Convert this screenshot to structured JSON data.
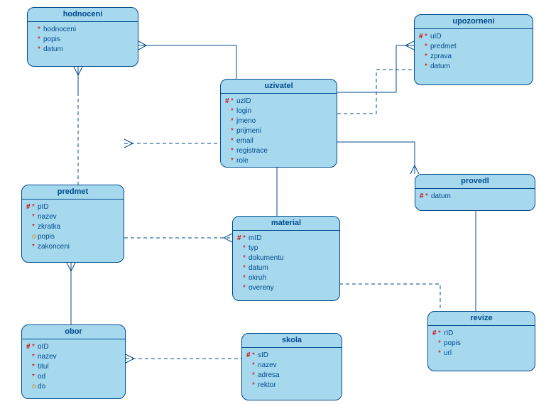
{
  "entities": {
    "hodnoceni": {
      "title": "hodnoceni",
      "attrs": [
        {
          "m": "*",
          "n": "hodnoceni"
        },
        {
          "m": "*",
          "n": "popis"
        },
        {
          "m": "*",
          "n": "datum"
        }
      ]
    },
    "upozorneni": {
      "title": "upozorneni",
      "attrs": [
        {
          "m": "#",
          "n": "uID"
        },
        {
          "m": "*",
          "n": "predmet"
        },
        {
          "m": "*",
          "n": "zprava"
        },
        {
          "m": "*",
          "n": "datum"
        }
      ]
    },
    "uzivatel": {
      "title": "uzivatel",
      "attrs": [
        {
          "m": "#",
          "n": "uzID"
        },
        {
          "m": "*",
          "n": "login"
        },
        {
          "m": "*",
          "n": "jmeno"
        },
        {
          "m": "*",
          "n": "prijmeni"
        },
        {
          "m": "*",
          "n": "email"
        },
        {
          "m": "*",
          "n": "registrace"
        },
        {
          "m": "*",
          "n": "role"
        }
      ]
    },
    "predmet": {
      "title": "predmet",
      "attrs": [
        {
          "m": "#",
          "n": "pID"
        },
        {
          "m": "*",
          "n": "nazev"
        },
        {
          "m": "*",
          "n": "zkratka"
        },
        {
          "m": "o",
          "n": "popis"
        },
        {
          "m": "*",
          "n": "zakonceni"
        }
      ]
    },
    "provedl": {
      "title": "provedl",
      "attrs": [
        {
          "m": "#",
          "n": "datum"
        }
      ]
    },
    "material": {
      "title": "material",
      "attrs": [
        {
          "m": "#",
          "n": "mID"
        },
        {
          "m": "*",
          "n": "typ"
        },
        {
          "m": "*",
          "n": "dokumentu"
        },
        {
          "m": "*",
          "n": "datum"
        },
        {
          "m": "*",
          "n": "okruh"
        },
        {
          "m": "*",
          "n": "overeny"
        }
      ]
    },
    "obor": {
      "title": "obor",
      "attrs": [
        {
          "m": "#",
          "n": "oID"
        },
        {
          "m": "*",
          "n": "nazev"
        },
        {
          "m": "*",
          "n": "titul"
        },
        {
          "m": "*",
          "n": "od"
        },
        {
          "m": "o",
          "n": "do"
        }
      ]
    },
    "skola": {
      "title": "skola",
      "attrs": [
        {
          "m": "#",
          "n": "sID"
        },
        {
          "m": "*",
          "n": "nazev"
        },
        {
          "m": "*",
          "n": "adresa"
        },
        {
          "m": "*",
          "n": "rektor"
        }
      ]
    },
    "revize": {
      "title": "revize",
      "attrs": [
        {
          "m": "#",
          "n": "rID"
        },
        {
          "m": "*",
          "n": "popis"
        },
        {
          "m": "*",
          "n": "url"
        }
      ]
    }
  }
}
